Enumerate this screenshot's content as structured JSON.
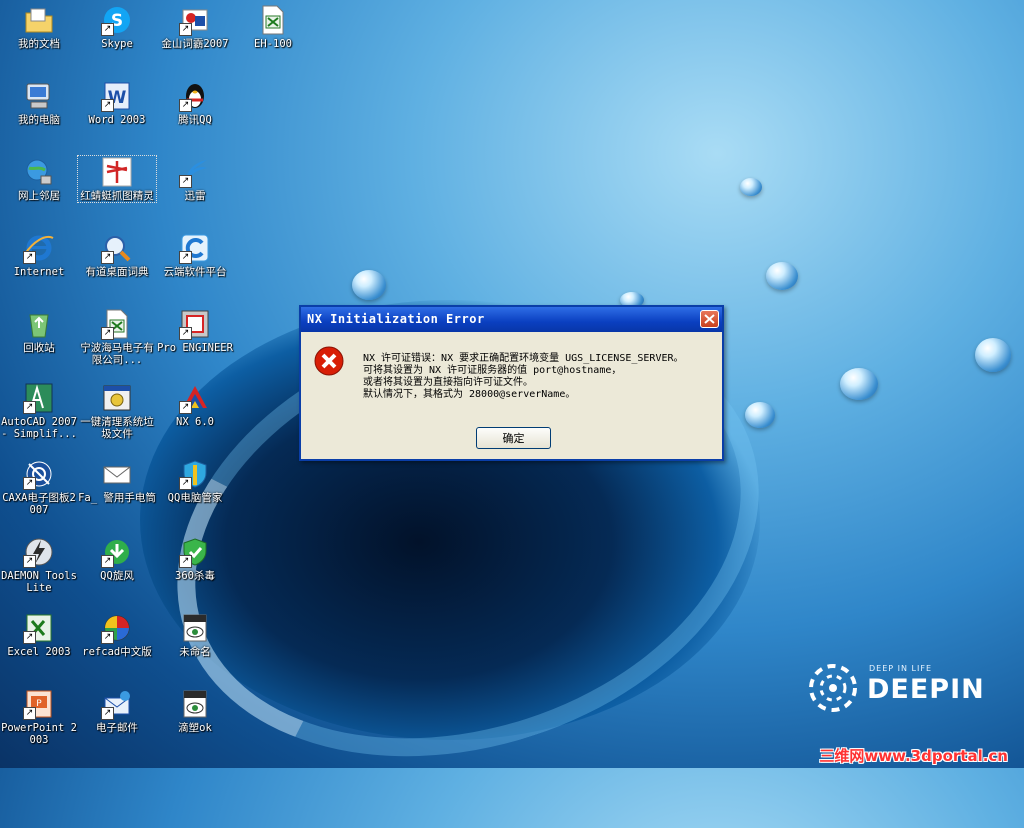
{
  "desktop": {
    "icons": [
      {
        "label": "我的文档",
        "icon": "my-documents-icon"
      },
      {
        "label": "Skype",
        "icon": "skype-icon"
      },
      {
        "label": "金山词霸2007",
        "icon": "kingsoft-powerword-icon"
      },
      {
        "label": "EH-100",
        "icon": "excel-file-icon"
      },
      {
        "label": "我的电脑",
        "icon": "my-computer-icon"
      },
      {
        "label": "Word 2003",
        "icon": "word-icon"
      },
      {
        "label": "腾讯QQ",
        "icon": "qq-penguin-icon"
      },
      {
        "label": "网上邻居",
        "icon": "network-places-icon"
      },
      {
        "label": "红蜻蜓抓图精灵",
        "icon": "dragonfly-capture-icon"
      },
      {
        "label": "迅雷",
        "icon": "thunder-icon"
      },
      {
        "label": "Internet",
        "icon": "internet-explorer-icon"
      },
      {
        "label": "有道桌面词典",
        "icon": "youdao-dictionary-icon"
      },
      {
        "label": "云端软件平台",
        "icon": "cloud-platform-icon"
      },
      {
        "label": "回收站",
        "icon": "recycle-bin-icon"
      },
      {
        "label": "宁波海马电子有限公司...",
        "icon": "excel-file-icon"
      },
      {
        "label": "Pro ENGINEER",
        "icon": "pro-engineer-icon"
      },
      {
        "label": "AutoCAD 2007 - Simplif...",
        "icon": "autocad-icon"
      },
      {
        "label": "一键清理系统垃圾文件",
        "icon": "cleanup-tool-icon"
      },
      {
        "label": "NX 6.0",
        "icon": "nx-icon"
      },
      {
        "label": "CAXA电子图板2007",
        "icon": "caxa-icon"
      },
      {
        "label": "Fa_ 警用手电筒",
        "icon": "envelope-icon"
      },
      {
        "label": "QQ电脑管家",
        "icon": "qq-manager-icon"
      },
      {
        "label": "DAEMON Tools Lite",
        "icon": "daemon-tools-icon"
      },
      {
        "label": "QQ旋风",
        "icon": "qq-whirlwind-icon"
      },
      {
        "label": "360杀毒",
        "icon": "antivirus-360-icon"
      },
      {
        "label": "Excel 2003",
        "icon": "excel-icon"
      },
      {
        "label": "refcad中文版",
        "icon": "refcad-icon"
      },
      {
        "label": "未命名",
        "icon": "jpeg-file-icon"
      },
      {
        "label": "PowerPoint 2003",
        "icon": "powerpoint-icon"
      },
      {
        "label": "电子邮件",
        "icon": "email-icon"
      },
      {
        "label": "滴塑ok",
        "icon": "jpeg-file-icon"
      }
    ]
  },
  "logo": {
    "tagline": "DEEP IN LIFE",
    "name": "DEEPIN"
  },
  "watermark": "三维网www.3dportal.cn",
  "dialog": {
    "title": "NX Initialization Error",
    "message_lines": [
      "NX 许可证错误：NX 要求正确配置环境变量 UGS_LICENSE_SERVER。",
      "可将其设置为 NX 许可证服务器的值 port@hostname，",
      "或者将其设置为直接指向许可证文件。",
      "默认情况下，其格式为 28000@serverName。"
    ],
    "ok_label": "确定",
    "icon": "error-icon"
  },
  "colors": {
    "title_bar": "#0a3fc0",
    "dialog_bg": "#ece9d8",
    "error_red": "#d81e06"
  }
}
